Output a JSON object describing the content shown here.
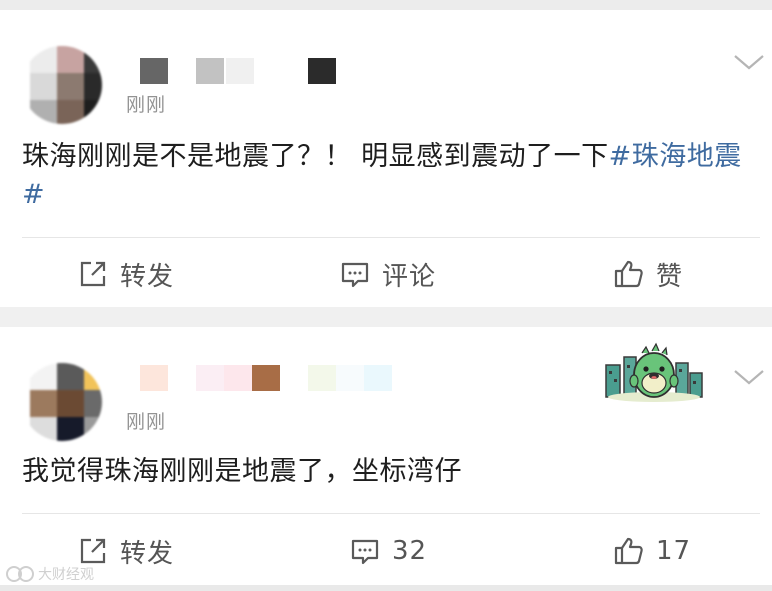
{
  "posts": [
    {
      "time": "刚刚",
      "text": "珠海刚刚是不是地震了？！ 明显感到震动了一下",
      "hashtag": "#珠海地震#",
      "actions": {
        "repost": "转发",
        "comment": "评论",
        "like": "赞"
      }
    },
    {
      "time": "刚刚",
      "text": "我觉得珠海刚刚是地震了，坐标湾仔",
      "actions": {
        "repost": "转发",
        "comment": "32",
        "like": "17"
      }
    }
  ],
  "watermark": {
    "text": "大财经观"
  },
  "icons": {
    "more": "chevron-down-icon",
    "repost": "share-square-icon",
    "comment": "chat-bubble-icon",
    "like": "thumbs-up-icon",
    "sticker": "green-dinosaur-sticker"
  },
  "colors": {
    "hashtag": "#3f6ba0",
    "meta_text": "#939393",
    "action_text": "#555555",
    "background": "#f0f0f0"
  }
}
